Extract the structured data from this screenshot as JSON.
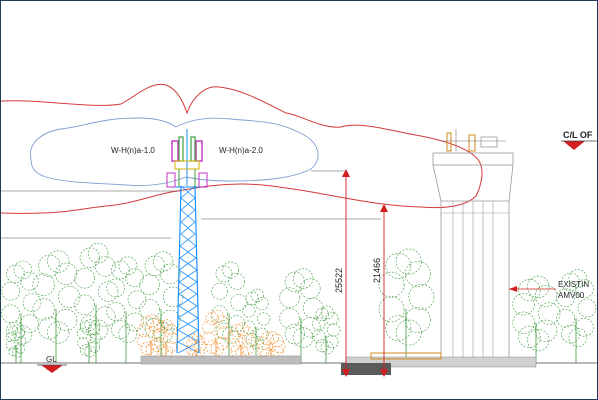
{
  "labels": {
    "coverage_left": "W-H(n)a-1.0",
    "coverage_right": "W-H(n)a-2.0",
    "ground_level": "GL",
    "height_antenna": "25522",
    "height_mast": "21466",
    "centerline": "C/L OF",
    "existing_structure_line1": "EXISTIN",
    "existing_structure_line2": "AMV00"
  },
  "colors": {
    "coverage_outline": "#d23a3a",
    "inner_coverage": "#7f9fd0",
    "mast": "#1e90ff",
    "tree_green": "#3f9b3f",
    "tree_orange": "#f08a24",
    "dimension": "#d21e1e",
    "structure": "#9a9a9a"
  },
  "icons": {
    "gl_marker": "triangle-down-icon",
    "cl_marker": "triangle-down-icon"
  }
}
